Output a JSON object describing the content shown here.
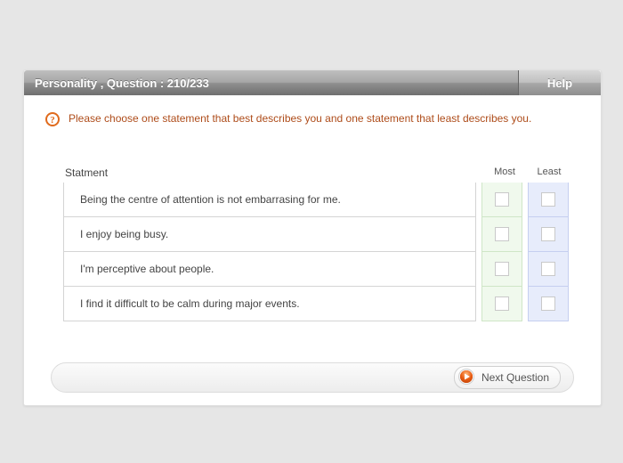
{
  "header": {
    "title": "Personality , Question : 210/233",
    "help_label": "Help"
  },
  "instruction": {
    "text": "Please choose one statement that best describes you and one statement that least describes you."
  },
  "columns": {
    "statement_label": "Statment",
    "most_label": "Most",
    "least_label": "Least"
  },
  "statements": [
    {
      "text": "Being the centre of attention is not embarrasing for me."
    },
    {
      "text": "I enjoy being busy."
    },
    {
      "text": "I'm perceptive about people."
    },
    {
      "text": "I find it difficult to be calm during major events."
    }
  ],
  "footer": {
    "next_label": "Next Question"
  },
  "icons": {
    "help_circle": "?",
    "play": "▶"
  },
  "colors": {
    "accent_text": "#ae4c1a",
    "most_bg": "#f0f9ed",
    "least_bg": "#e7ecfb",
    "play_fill": "#e95d13"
  }
}
